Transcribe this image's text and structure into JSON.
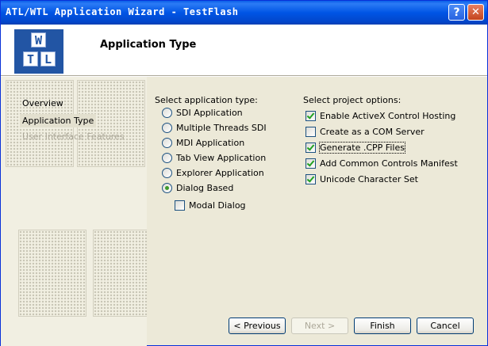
{
  "window": {
    "title": "ATL/WTL Application Wizard - TestFlash"
  },
  "titlebar_buttons": {
    "help": "?",
    "close": "✕"
  },
  "header": {
    "title": "Application Type",
    "logo_tiles": [
      "W",
      "T",
      "L"
    ]
  },
  "sidebar": {
    "items": [
      {
        "label": "Overview",
        "state": "normal"
      },
      {
        "label": "Application Type",
        "state": "active"
      },
      {
        "label": "User Interface Features",
        "state": "disabled"
      }
    ]
  },
  "app_type": {
    "label": "Select application type:",
    "options": [
      {
        "label": "SDI Application",
        "selected": false
      },
      {
        "label": "Multiple Threads SDI",
        "selected": false
      },
      {
        "label": "MDI Application",
        "selected": false
      },
      {
        "label": "Tab View Application",
        "selected": false
      },
      {
        "label": "Explorer Application",
        "selected": false
      },
      {
        "label": "Dialog Based",
        "selected": true
      }
    ],
    "modal": {
      "label": "Modal Dialog",
      "checked": false
    }
  },
  "project_options": {
    "label": "Select project options:",
    "options": [
      {
        "label": "Enable ActiveX Control Hosting",
        "checked": true
      },
      {
        "label": "Create as a COM Server",
        "checked": false
      },
      {
        "label": "Generate .CPP Files",
        "checked": true
      },
      {
        "label": "Add Common Controls Manifest",
        "checked": true
      },
      {
        "label": "Unicode Character Set",
        "checked": true
      }
    ]
  },
  "buttons": {
    "previous": "< Previous",
    "next": "Next >",
    "finish": "Finish",
    "cancel": "Cancel"
  }
}
